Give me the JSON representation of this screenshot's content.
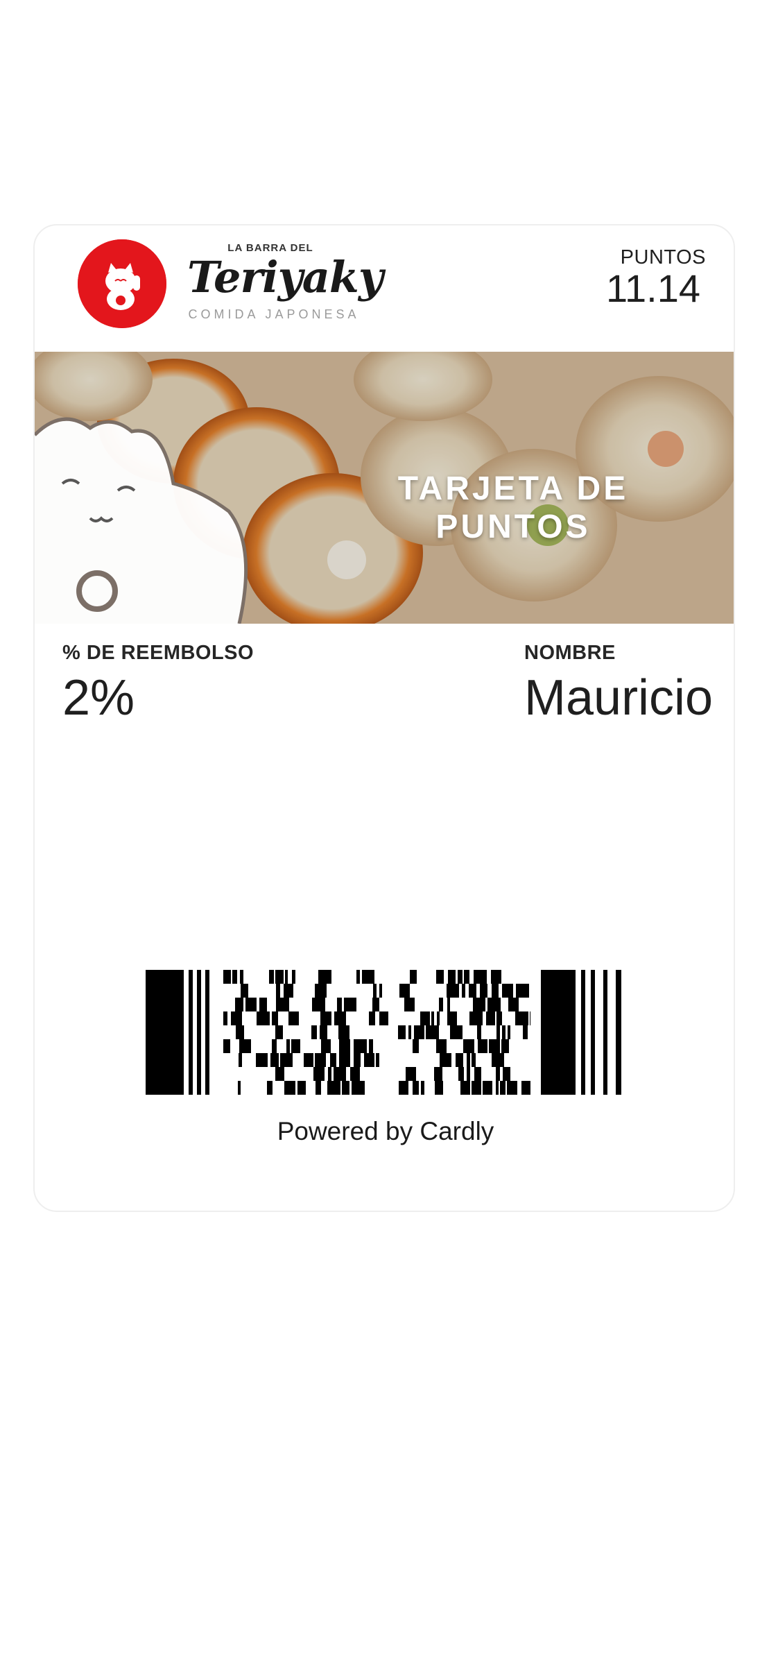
{
  "card": {
    "brand": {
      "top_line": "LA BARRA DEL",
      "name": "Teriyaky",
      "subtitle": "COMIDA JAPONESA",
      "color": "#e3161c"
    },
    "points": {
      "label": "PUNTOS",
      "value": "11.14"
    },
    "banner": {
      "title": "TARJETA DE PUNTOS",
      "image": "sushi-rolls-with-lucky-cat"
    },
    "fields": {
      "refund_label": "% DE REEMBOLSO",
      "refund_value": "2%",
      "name_label": "NOMBRE",
      "name_value": "Mauricio"
    },
    "footer": {
      "powered_by": "Powered by Cardly"
    }
  }
}
